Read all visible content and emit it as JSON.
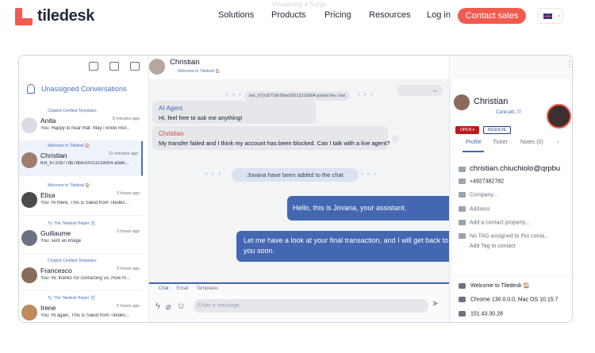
{
  "nav": {
    "logo": "tiledesk",
    "items": [
      "Solutions",
      "Products",
      "Pricing",
      "Resources",
      "Log in"
    ],
    "ghost_text": "Visualizing a Surge",
    "contact": "Contact sales"
  },
  "left": {
    "header": "Unassigned Conversations",
    "conversations": [
      {
        "source": "Chatbot Certified Templates",
        "name": "Anita",
        "time": "3 minutes ago",
        "message": "You: Happy to hear that. May I know mor..."
      },
      {
        "source": "Welcome to Tiledesk 🏠",
        "name": "Christian",
        "time": "11 minutes ago",
        "message": "bot_672c877db7bbe20013218d04 adde..."
      },
      {
        "source": "Welcome to Tiledesk 🏠",
        "name": "Elisa",
        "time": "3 hours ago",
        "message": "You: Hi there, This is Saeid from Tiledes..."
      },
      {
        "source": "Ty: The Tiledesk Helper 🛠",
        "name": "Guillaume",
        "time": "3 hours ago",
        "message": "You: sent an image"
      },
      {
        "source": "Chatbot Certified Templates",
        "name": "Francesco",
        "time": "3 hours ago",
        "message": "You: Hi, thanks for contacting us. How m..."
      },
      {
        "source": "Ty: The Tiledesk Helper 🛠",
        "name": "Irene",
        "time": "5 hours ago",
        "message": "You: Hi again, This is Saeid from Tiledes..."
      }
    ]
  },
  "chat": {
    "name": "Christian",
    "subtitle": "Welcome to Tiledesk 🏠",
    "join_notice": "bot_672c877db7bbe20013218d04 joined the chat",
    "messages": [
      {
        "who": "AI Agent",
        "text": "Hi, feel free to ask me anything!"
      },
      {
        "who": "Christian",
        "text": "My transfer failed and I think my account has been blocked. Can I talk with a live agent?"
      }
    ],
    "added_notice": "Jovana have been added to the chat",
    "agent_messages": [
      "Hello, this is Jovana, your assistant.",
      "Let me have a look at your final transaction, and I will get back to you soon."
    ],
    "composer_tabs": [
      "Chat",
      "Email",
      "Templates"
    ],
    "placeholder": "Enter a message"
  },
  "profile": {
    "name": "Christian",
    "location": "Canicattì, IT",
    "open": "OPEN ▾",
    "resolve": "RESOLVE",
    "tabs": [
      "Profile",
      "Ticket",
      "Notes (0)"
    ],
    "email": "christian.chiuchiolo@qrpbu",
    "phone": "+4927382782",
    "company": "Company...",
    "address": "Address",
    "add_property": "Add a contact property...",
    "no_tag": "No TAG assigned to this conta...",
    "add_tag": "Add Tag to contact",
    "channel": "Welcome to Tiledesk 🏠",
    "browser": "Chrome 130.0.0.0, Mac OS 10.15.7",
    "ip": "151.43.30.28"
  }
}
